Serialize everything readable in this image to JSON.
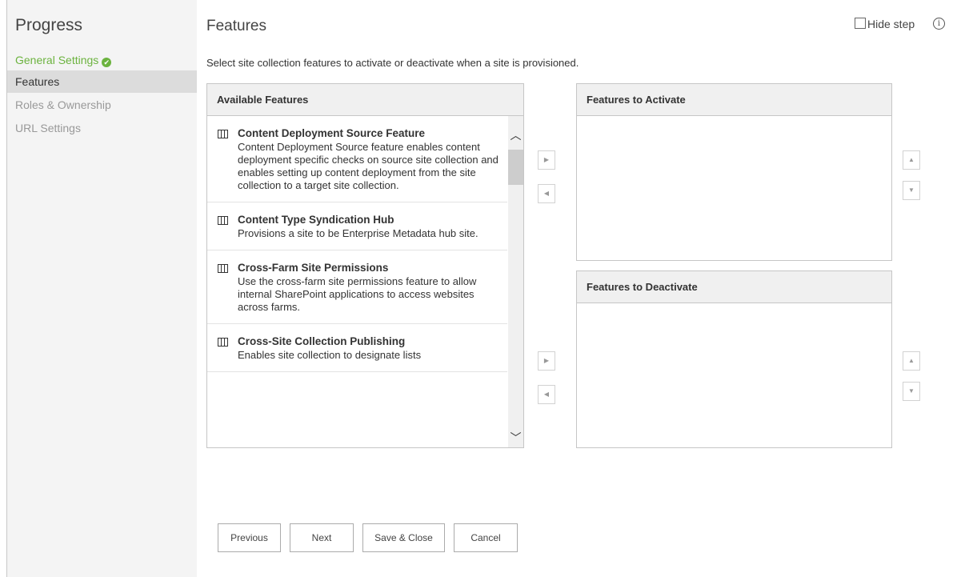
{
  "sidebar": {
    "title": "Progress",
    "steps": [
      {
        "label": "General Settings",
        "state": "done"
      },
      {
        "label": "Features",
        "state": "current"
      },
      {
        "label": "Roles & Ownership",
        "state": "future"
      },
      {
        "label": "URL Settings",
        "state": "future"
      }
    ],
    "check_glyph": "✔"
  },
  "main": {
    "title": "Features",
    "hide_step_label": "Hide step",
    "info_glyph": "i",
    "description": "Select site collection features to activate or deactivate when a site is provisioned."
  },
  "available": {
    "header": "Available Features",
    "items": [
      {
        "title": "Content Deployment Source Feature",
        "description": "Content Deployment Source feature enables content deployment specific checks on source site collection and enables setting up content deployment from the site collection to a target site collection."
      },
      {
        "title": "Content Type Syndication Hub",
        "description": "Provisions a site to be Enterprise Metadata hub site."
      },
      {
        "title": "Cross-Farm Site Permissions",
        "description": "Use the cross-farm site permissions feature to allow internal SharePoint applications to access websites across farms."
      },
      {
        "title": "Cross-Site Collection Publishing",
        "description": "Enables site collection to designate lists"
      }
    ]
  },
  "activate": {
    "header": "Features to Activate"
  },
  "deactivate": {
    "header": "Features to Deactivate"
  },
  "glyphs": {
    "move_right": "▶",
    "move_left": "◀",
    "move_up": "▲",
    "move_down": "▼",
    "scroll_up": "︿",
    "scroll_down": "﹀"
  },
  "footer": {
    "previous": "Previous",
    "next": "Next",
    "save_close": "Save & Close",
    "cancel": "Cancel"
  },
  "colors": {
    "done": "#6cb33f",
    "current_bg": "#dcdcdc",
    "future": "#999999"
  }
}
